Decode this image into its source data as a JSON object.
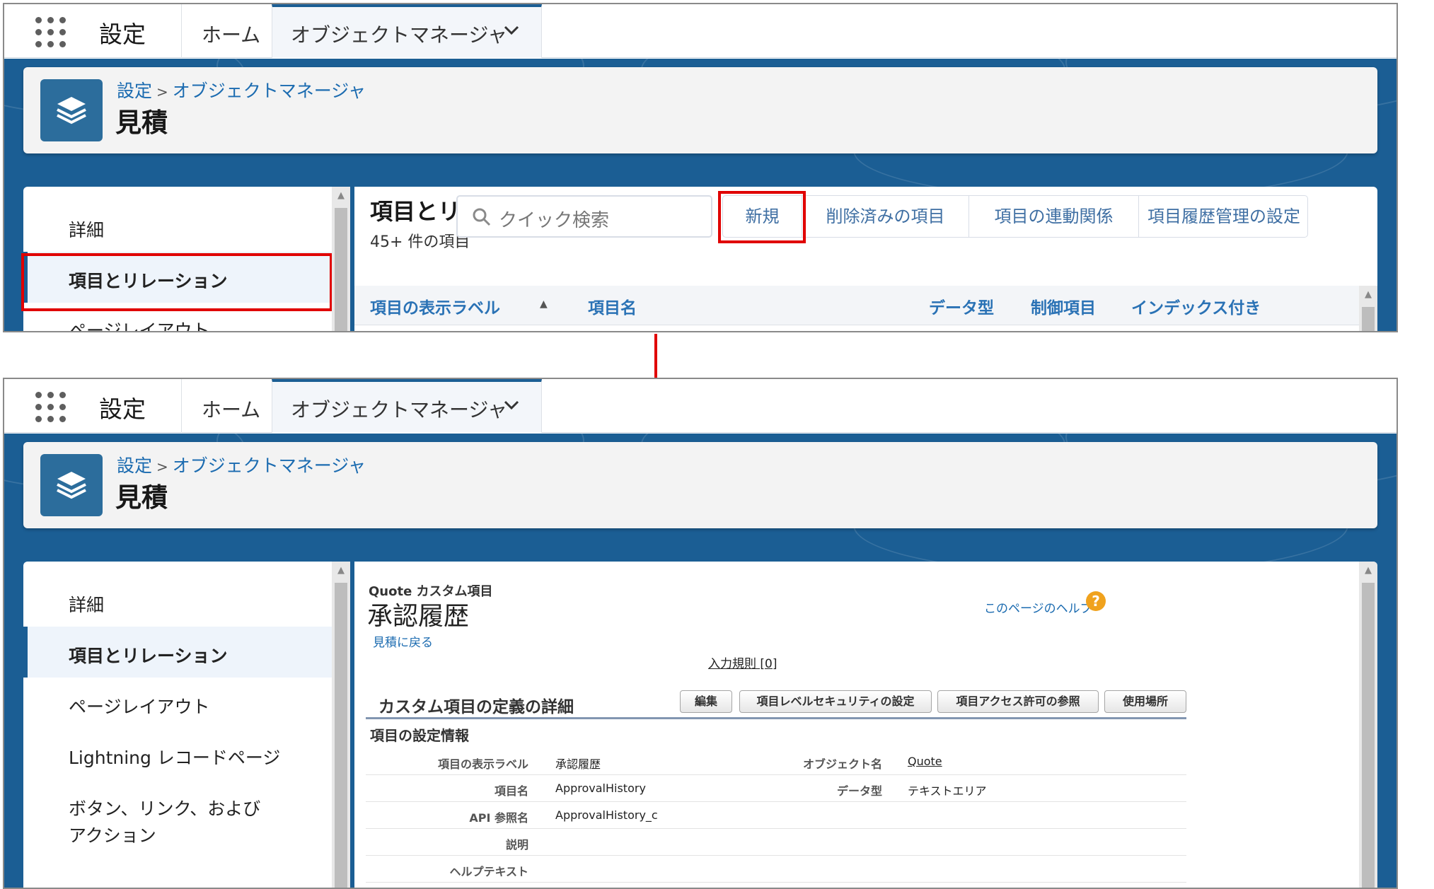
{
  "app": {
    "name": "設定",
    "nav_home": "ホーム",
    "nav_object_manager": "オブジェクトマネージャ"
  },
  "header": {
    "breadcrumb_setup": "設定",
    "breadcrumb_sep": ">",
    "breadcrumb_object_manager": "オブジェクトマネージャ",
    "object_title": "見積"
  },
  "sidebar": {
    "items": [
      {
        "label": "詳細"
      },
      {
        "label": "項目とリレーション"
      },
      {
        "label": "ページレイアウト"
      },
      {
        "label": "Lightning レコードページ"
      },
      {
        "label": "ボタン、リンク、および"
      },
      {
        "label": "アクション"
      }
    ]
  },
  "fields_panel": {
    "title": "項目とリ",
    "count_text": "45+ 件の項目",
    "search_placeholder": "クイック検索",
    "buttons": {
      "new": "新規",
      "deleted": "削除済みの項目",
      "dependencies": "項目の連動関係",
      "history": "項目履歴管理の設定"
    },
    "columns": {
      "label": "項目の表示ラベル",
      "sort_indicator": "▲",
      "name": "項目名",
      "type": "データ型",
      "controlling": "制御項目",
      "indexed": "インデックス付き"
    }
  },
  "detail_panel": {
    "subtitle": "Quote カスタム項目",
    "title": "承認履歴",
    "back_link": "見積に戻る",
    "help_link": "このページのヘルプ",
    "help_glyph": "?",
    "rules_link": "入力規則 [0]",
    "section_title": "カスタム項目の定義の詳細",
    "buttons": {
      "edit": "編集",
      "fls": "項目レベルセキュリティの設定",
      "access": "項目アクセス許可の参照",
      "where_used": "使用場所"
    },
    "subsection_title": "項目の設定情報",
    "rows": [
      {
        "label": "項目の表示ラベル",
        "value": "承認履歴",
        "label2": "オブジェクト名",
        "value2": "Quote"
      },
      {
        "label": "項目名",
        "value": "ApprovalHistory",
        "label2": "データ型",
        "value2": "テキストエリア"
      },
      {
        "label": "API 参照名",
        "value": "ApprovalHistory_c"
      },
      {
        "label": "説明",
        "value": ""
      },
      {
        "label": "ヘルプテキスト",
        "value": ""
      }
    ]
  },
  "colors": {
    "brand_blue": "#1b5e94",
    "highlight_red": "#e00000",
    "link_blue": "#1b6bb0"
  }
}
